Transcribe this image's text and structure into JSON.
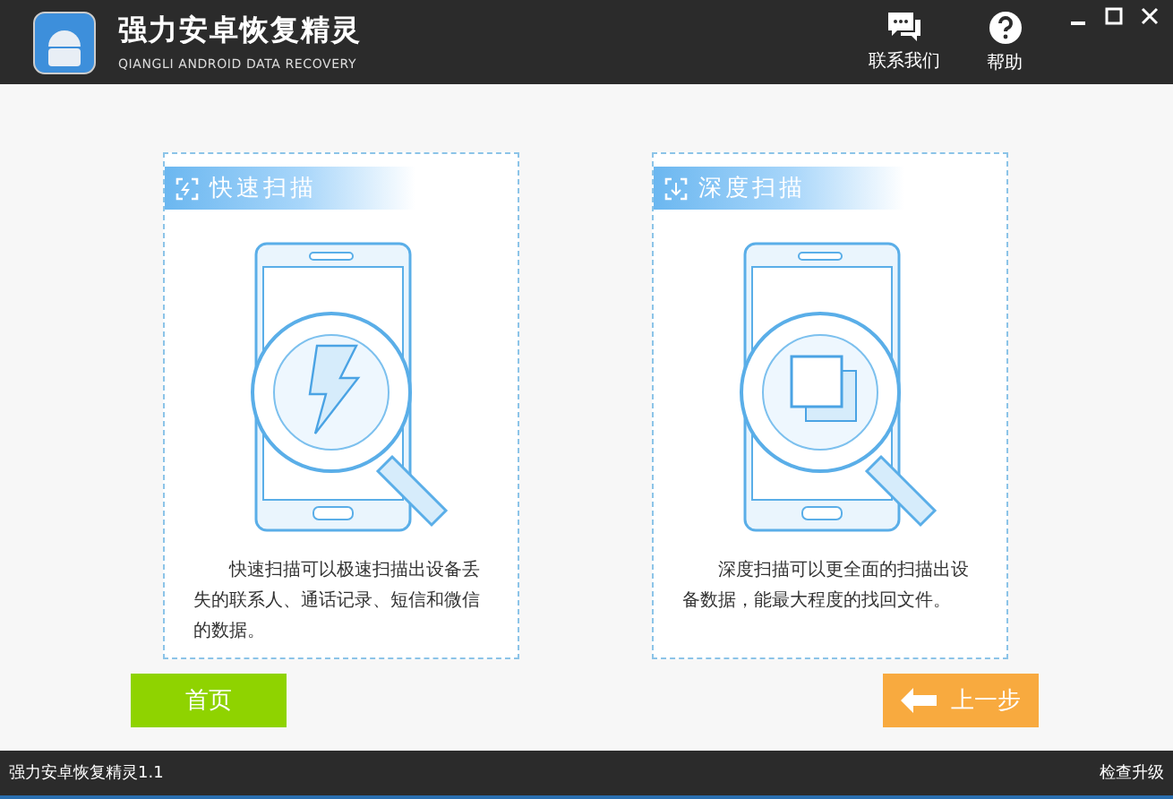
{
  "header": {
    "title": "强力安卓恢复精灵",
    "subtitle": "QIANGLI ANDROID DATA RECOVERY",
    "actions": [
      {
        "kind": "contact",
        "label": "联系我们"
      },
      {
        "kind": "help",
        "label": "帮助"
      }
    ]
  },
  "modes": [
    {
      "kind": "quick",
      "title": "快速扫描",
      "description": "快速扫描可以极速扫描出设备丢失的联系人、通话记录、短信和微信的数据。"
    },
    {
      "kind": "deep",
      "title": "深度扫描",
      "description": "深度扫描可以更全面的扫描出设备数据，能最大程度的找回文件。"
    }
  ],
  "buttons": [
    {
      "kind": "home",
      "label": "首页"
    },
    {
      "kind": "back",
      "label": "上一步"
    }
  ],
  "status_bar": {
    "version": "强力安卓恢复精灵1.1",
    "update": "检查升级"
  }
}
